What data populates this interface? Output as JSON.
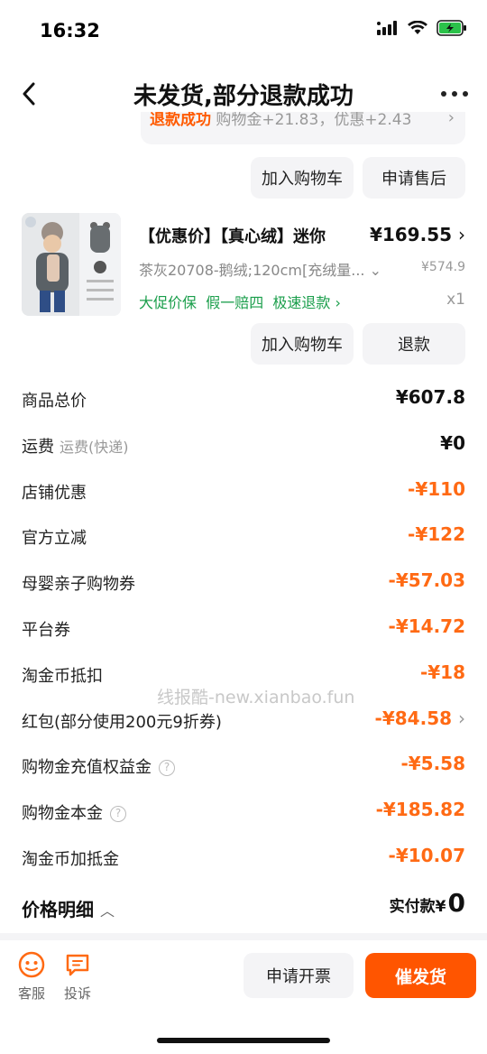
{
  "status_bar": {
    "time": "16:32"
  },
  "header": {
    "title": "未发货,部分退款成功"
  },
  "refund_banner": {
    "status": "退款成功",
    "text": "购物金+21.83，优惠+2.43"
  },
  "item1_actions": {
    "add_to_cart": "加入购物车",
    "after_sale": "申请售后"
  },
  "product": {
    "name": "【优惠价】【真心绒】迷你",
    "price": "¥169.55",
    "sku": "茶灰20708-鹅绒;120cm[充绒量...",
    "original_price": "¥574.9",
    "tags": [
      "大促价保",
      "假一赔四",
      "极速退款"
    ],
    "quantity": "x1"
  },
  "item2_actions": {
    "add_to_cart": "加入购物车",
    "refund": "退款"
  },
  "price_rows": [
    {
      "label": "商品总价",
      "value": "¥607.8"
    },
    {
      "label": "运费",
      "sub": "运费(快递)",
      "value": "¥0"
    },
    {
      "label": "店铺优惠",
      "value": "-¥110"
    },
    {
      "label": "官方立减",
      "value": "-¥122"
    },
    {
      "label": "母婴亲子购物券",
      "value": "-¥57.03"
    },
    {
      "label": "平台券",
      "value": "-¥14.72"
    },
    {
      "label": "淘金币抵扣",
      "value": "-¥18"
    },
    {
      "label": "红包(部分使用200元9折券)",
      "value": "-¥84.58"
    },
    {
      "label": "购物金充值权益金",
      "value": "-¥5.58"
    },
    {
      "label": "购物金本金",
      "value": "-¥185.82"
    },
    {
      "label": "淘金币加抵金",
      "value": "-¥10.07"
    }
  ],
  "watermark": "线报酷-new.xianbao.fun",
  "price_detail": {
    "label": "价格明细",
    "paid_label": "实付款¥",
    "paid_value": "0"
  },
  "footer": {
    "service_label": "客服",
    "complaint_label": "投诉",
    "invoice_button": "申请开票",
    "urge_button": "催发货"
  },
  "colors": {
    "accent": "#ff5500",
    "discount": "#ff6a14",
    "tag_green": "#1a9e4b"
  }
}
